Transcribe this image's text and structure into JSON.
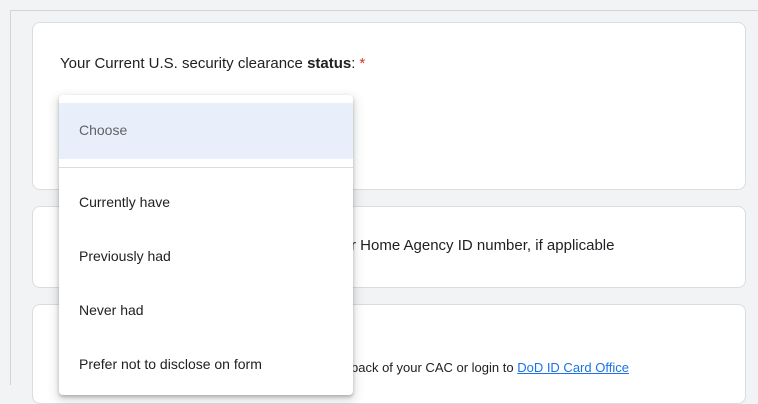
{
  "card1": {
    "question_prefix": "Your Current U.S. security clearance ",
    "question_bold": "status",
    "question_suffix": ":",
    "required_mark": "*"
  },
  "dropdown": {
    "selected": "Choose",
    "options": [
      "Currently have",
      "Previously had",
      "Never had",
      "Prefer not to disclose on form"
    ]
  },
  "card2": {
    "visible_text": "r Home Agency ID number, if applicable"
  },
  "card3": {
    "visible_text": "back of your CAC or login to ",
    "link_text": "DoD ID Card Office"
  },
  "colors": {
    "required": "#d93025",
    "link": "#1a73e8",
    "selected_bg": "#e8effb"
  }
}
